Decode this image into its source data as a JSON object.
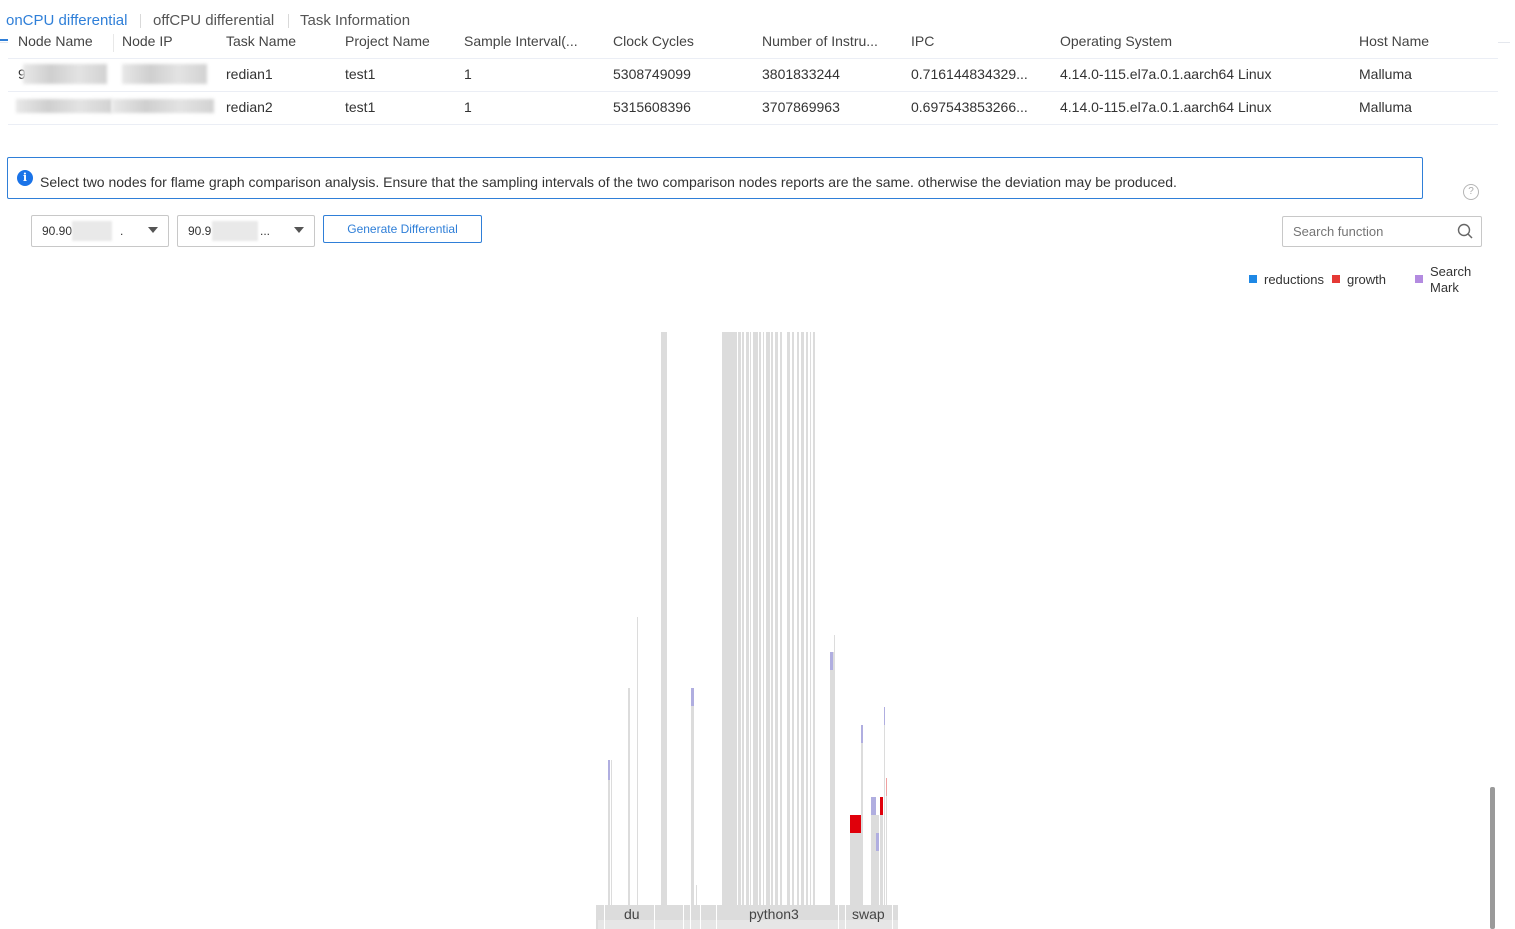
{
  "tabs": [
    {
      "label": "onCPU differential"
    },
    {
      "label": "offCPU differential"
    },
    {
      "label": "Task Information"
    }
  ],
  "table": {
    "columns": [
      "Node Name",
      "Node IP",
      "Task Name",
      "Project Name",
      "Sample Interval(...",
      "Clock Cycles",
      "Number of Instru...",
      "IPC",
      "Operating System",
      "Host Name"
    ],
    "rows": [
      {
        "node_name": "9",
        "node_ip": "",
        "task_name": "redian1",
        "project_name": "test1",
        "sample_interval": "1",
        "clock_cycles": "5308749099",
        "instructions": "3801833244",
        "ipc": "0.716144834329...",
        "os": "4.14.0-115.el7a.0.1.aarch64 Linux",
        "host": "Malluma"
      },
      {
        "node_name": "",
        "node_ip": "",
        "task_name": "redian2",
        "project_name": "test1",
        "sample_interval": "1",
        "clock_cycles": "5315608396",
        "instructions": "3707869963",
        "ipc": "0.697543853266...",
        "os": "4.14.0-115.el7a.0.1.aarch64 Linux",
        "host": "Malluma"
      }
    ]
  },
  "info": {
    "icon": "info-icon",
    "text": "Select two nodes for flame graph comparison analysis. Ensure that the sampling intervals of the two comparison nodes reports are the same. otherwise the deviation may be produced."
  },
  "controls": {
    "node_select_1": "90.90",
    "node_select_1_suffix": ".",
    "node_select_2": "90.9",
    "node_select_2_suffix": "...",
    "generate_button": "Generate Differential",
    "search_placeholder": "Search function"
  },
  "legend": {
    "items": [
      {
        "label": "reductions",
        "color": "#1e88e5"
      },
      {
        "label": "growth",
        "color": "#e53935"
      },
      {
        "label": "Search Mark",
        "color": "#b38be0"
      }
    ]
  },
  "flame": {
    "labels": [
      "du",
      "python3",
      "swap"
    ],
    "colors": {
      "neutral": "#dcdcdc",
      "growth": "#e0000b",
      "reduction": "#1e88e5",
      "search": "#b0aee0"
    }
  }
}
